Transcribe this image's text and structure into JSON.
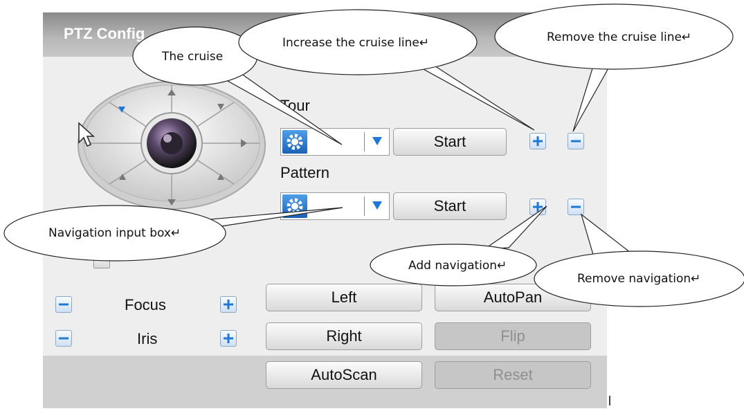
{
  "window": {
    "title": "PTZ Config"
  },
  "tour": {
    "label": "Tour",
    "start_label": "Start"
  },
  "pattern": {
    "label": "Pattern",
    "start_label": "Start"
  },
  "lens": {
    "focus_label": "Focus",
    "iris_label": "Iris"
  },
  "buttons": {
    "left": "Left",
    "autopan": "AutoPan",
    "right": "Right",
    "flip": "Flip",
    "autoscan": "AutoScan",
    "reset": "Reset"
  },
  "callouts": {
    "cruise": "The  cruise",
    "increase": "Increase the cruise line↵",
    "remove_cruise": "Remove the cruise line↵",
    "nav_input": "Navigation input box↵",
    "add_nav": "Add navigation↵",
    "remove_nav": "Remove navigation↵"
  },
  "colors": {
    "accent": "#1e78d6",
    "panel": "#d4d4d4",
    "inner": "#eeeeee"
  }
}
